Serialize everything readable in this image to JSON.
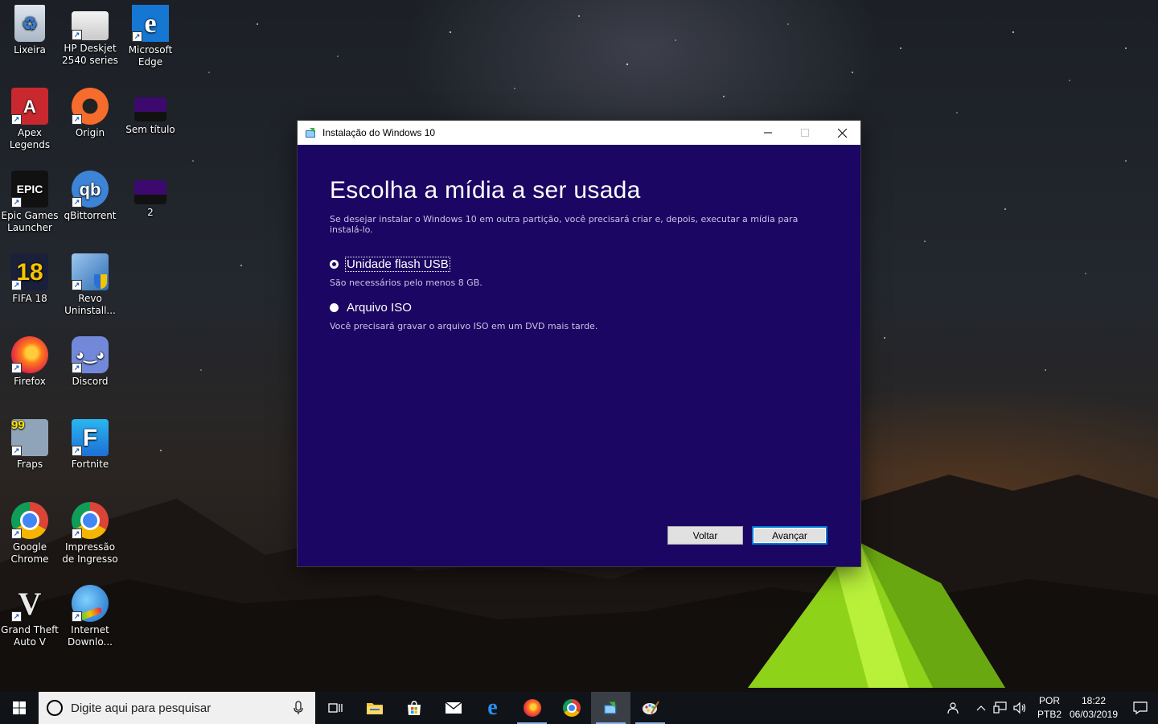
{
  "desktop": {
    "icons": [
      {
        "label": "Lixeira"
      },
      {
        "label": "HP Deskjet 2540 series"
      },
      {
        "label": "Microsoft Edge"
      },
      {
        "label": "Apex Legends"
      },
      {
        "label": "Origin"
      },
      {
        "label": "Sem título"
      },
      {
        "label": "Epic Games Launcher"
      },
      {
        "label": "qBittorrent"
      },
      {
        "label": "2"
      },
      {
        "label": "FIFA 18"
      },
      {
        "label": "Revo Uninstall..."
      },
      {
        "label": "Firefox"
      },
      {
        "label": "Discord"
      },
      {
        "label": "Fraps"
      },
      {
        "label": "Fortnite"
      },
      {
        "label": "Google Chrome"
      },
      {
        "label": "Impressão de Ingresso"
      },
      {
        "label": "Grand Theft Auto V"
      },
      {
        "label": "Internet Downlo..."
      }
    ]
  },
  "dialog": {
    "title": "Instalação do Windows 10",
    "heading": "Escolha a mídia a ser usada",
    "subtitle": "Se desejar instalar o Windows 10 em outra partição, você precisará criar e, depois, executar a mídia para instalá-lo.",
    "options": [
      {
        "label": "Unidade flash USB",
        "description": "São necessários pelo menos 8 GB.",
        "selected": true
      },
      {
        "label": "Arquivo ISO",
        "description": "Você precisará gravar o arquivo ISO em um DVD mais tarde.",
        "selected": false
      }
    ],
    "back_label": "Voltar",
    "next_label": "Avançar"
  },
  "taskbar": {
    "search_placeholder": "Digite aqui para pesquisar",
    "tray": {
      "lang_top": "POR",
      "lang_bottom": "PTB2",
      "time": "18:22",
      "date": "06/03/2019"
    }
  }
}
